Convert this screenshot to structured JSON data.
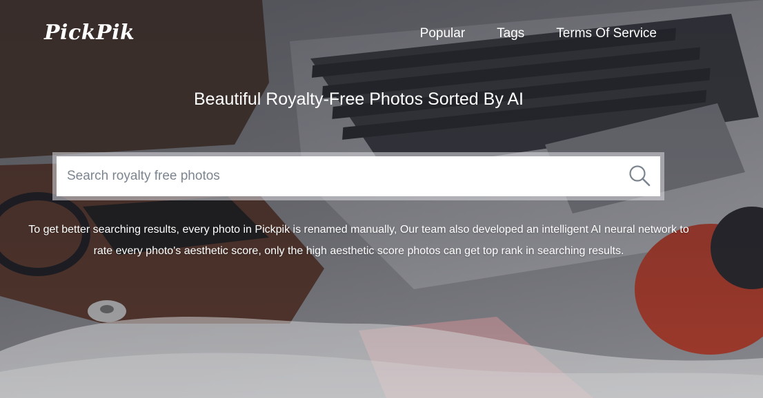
{
  "brand": {
    "logo": "PickPik"
  },
  "nav": [
    {
      "label": "Popular"
    },
    {
      "label": "Tags"
    },
    {
      "label": "Terms Of Service"
    }
  ],
  "hero": {
    "headline": "Beautiful Royalty-Free Photos Sorted By AI",
    "description": "To get better searching results, every photo in Pickpik is renamed manually, Our team also developed an intelligent AI neural network to rate every photo's aesthetic score, only the high aesthetic score photos can get top rank in searching results."
  },
  "search": {
    "placeholder": "Search royalty free photos",
    "value": "",
    "icon": "search-icon"
  },
  "colors": {
    "overlay": "#3a3b42",
    "accent_red": "#b6402e",
    "text": "#ffffff"
  }
}
